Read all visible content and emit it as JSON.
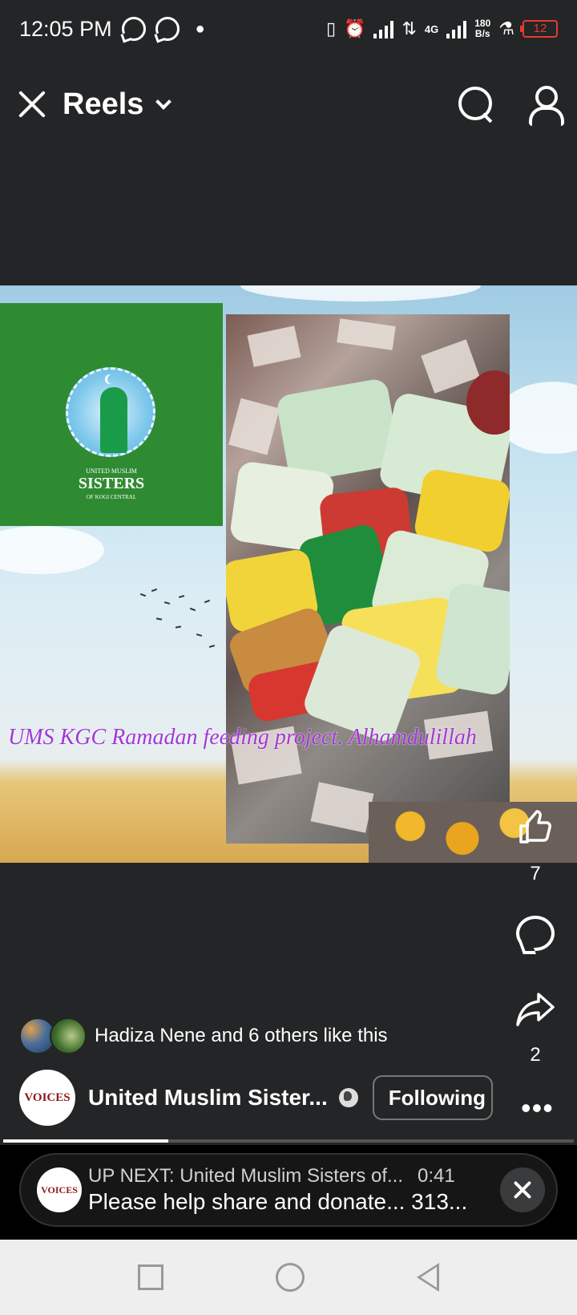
{
  "status_bar": {
    "time": "12:05 PM",
    "network_type": "4G",
    "speed_value": "180",
    "speed_unit": "B/s",
    "battery": "12"
  },
  "header": {
    "title": "Reels"
  },
  "video": {
    "logo_line1": "UNITED MUSLIM",
    "logo_line2": "SISTERS",
    "logo_line3": "OF KOGI CENTRAL",
    "caption": "UMS KGC Ramadan feeding project. Alhamdulillah"
  },
  "actions": {
    "like_count": "7",
    "share_count": "2"
  },
  "likes": {
    "text": "Hadiza Nene and 6 others like this"
  },
  "page": {
    "name": "United Muslim Sister...",
    "avatar_text": "VOICES",
    "follow_label": "Following"
  },
  "progress": {
    "fraction": 0.29
  },
  "up_next": {
    "title": "UP NEXT: United Muslim Sisters of...",
    "duration": "0:41",
    "subtitle": "Please help share and donate... 313..."
  },
  "colors": {
    "background": "#242526",
    "caption": "#a238d6",
    "battery": "#e53935"
  }
}
